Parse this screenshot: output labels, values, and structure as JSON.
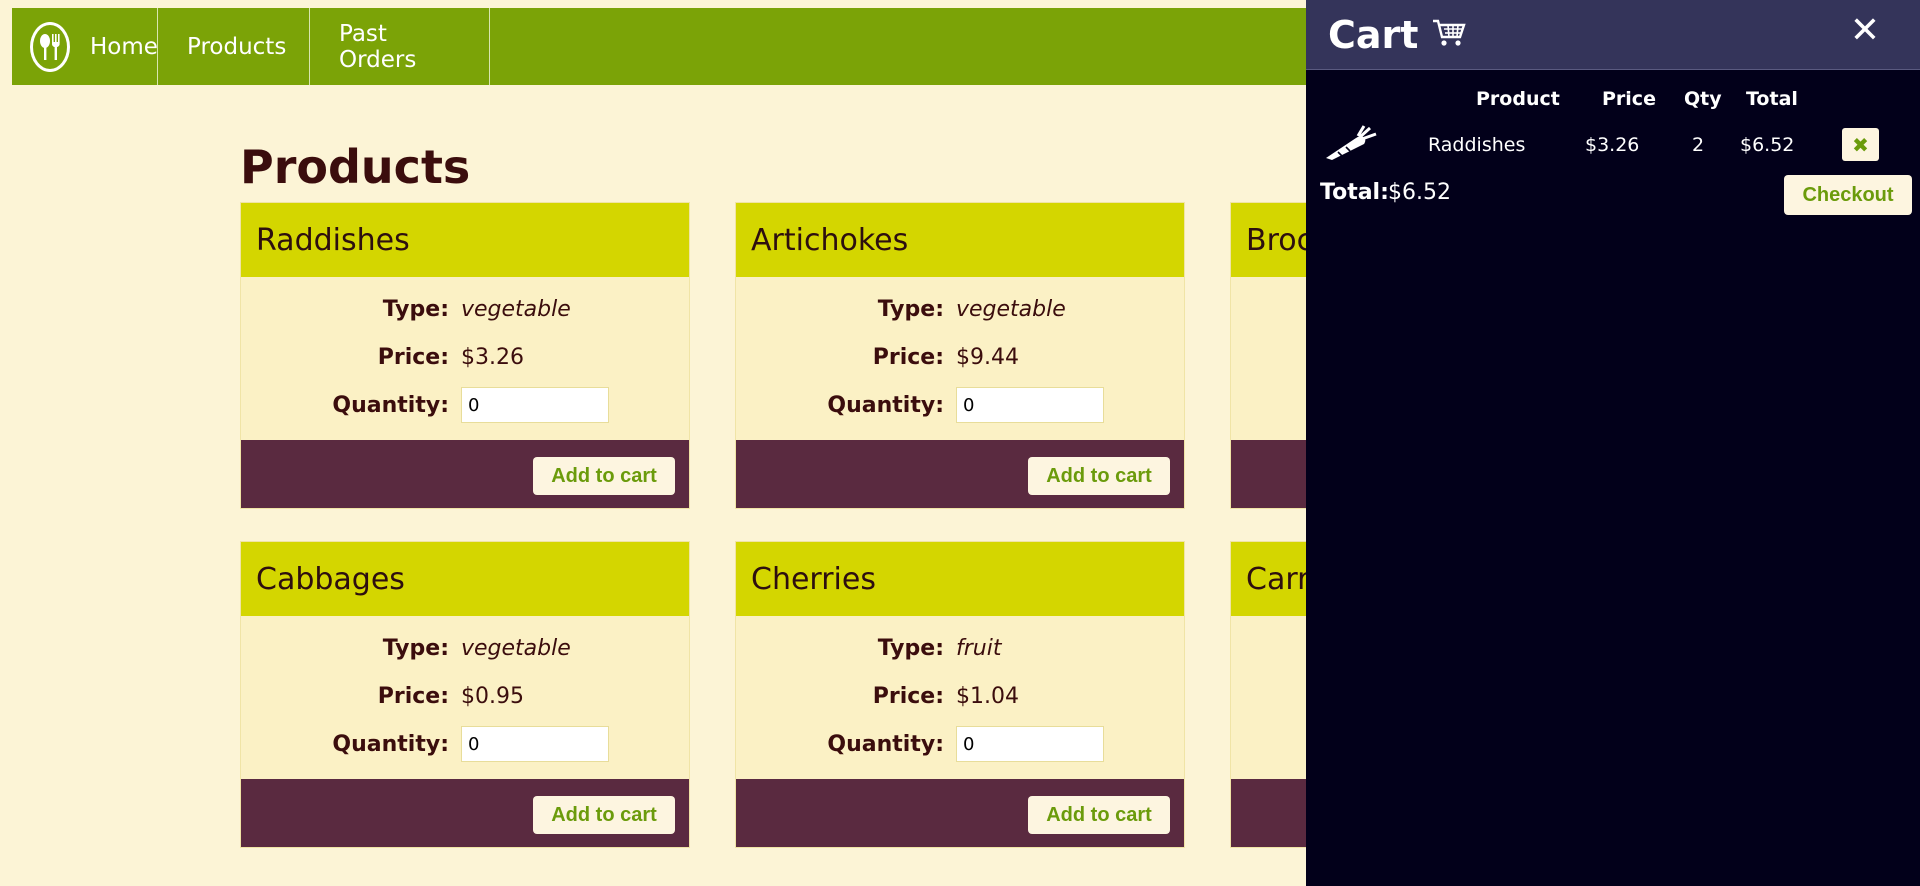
{
  "nav": {
    "items": [
      {
        "label": "Home"
      },
      {
        "label": "Products"
      },
      {
        "label": "Past Orders"
      }
    ]
  },
  "main": {
    "title": "Products",
    "labels": {
      "type": "Type:",
      "price": "Price:",
      "quantity": "Quantity:",
      "add_to_cart": "Add to cart"
    },
    "products": [
      {
        "name": "Raddishes",
        "type": "vegetable",
        "price": "$3.26",
        "quantity": "0"
      },
      {
        "name": "Artichokes",
        "type": "vegetable",
        "price": "$9.44",
        "quantity": "0"
      },
      {
        "name": "Broc",
        "type": "",
        "price": "",
        "quantity": ""
      },
      {
        "name": "Cabbages",
        "type": "vegetable",
        "price": "$0.95",
        "quantity": "0"
      },
      {
        "name": "Cherries",
        "type": "fruit",
        "price": "$1.04",
        "quantity": "0"
      },
      {
        "name": "Carr",
        "type": "",
        "price": "",
        "quantity": ""
      }
    ]
  },
  "cart": {
    "title": "Cart",
    "columns": {
      "product": "Product",
      "price": "Price",
      "qty": "Qty",
      "total": "Total"
    },
    "items": [
      {
        "product": "Raddishes",
        "price": "$3.26",
        "qty": "2",
        "total": "$6.52",
        "icon": "carrot-icon"
      }
    ],
    "total_label": "Total:",
    "total_value": "$6.52",
    "checkout_label": "Checkout"
  },
  "colors": {
    "nav_green": "#7ba307",
    "card_header": "#d4d600",
    "card_footer": "#5a2a40",
    "page_bg": "#fcf4d6",
    "cart_bg": "#02001a",
    "cart_header": "#34345a"
  }
}
